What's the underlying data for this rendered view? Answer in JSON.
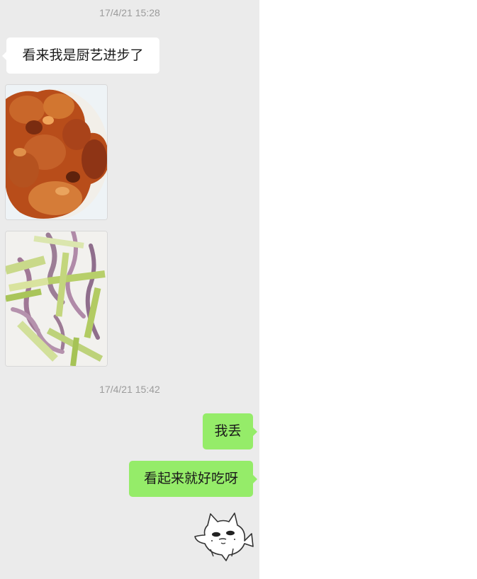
{
  "conversation": {
    "timestamp_1": "17/4/21 15:28",
    "message_1": "看来我是厨艺进步了",
    "photo_1_icon": "braised-chicken-wings-photo",
    "photo_2_icon": "squid-celery-stirfry-photo",
    "timestamp_2": "17/4/21 15:42",
    "message_2": "我丢",
    "message_3": "看起来就好吃呀",
    "sticker_icon": "cat-fish-sticker"
  },
  "colors": {
    "chat_background": "#ebebeb",
    "incoming_bubble": "#ffffff",
    "outgoing_bubble": "#95ec69",
    "timestamp_text": "#9b9b9b"
  }
}
